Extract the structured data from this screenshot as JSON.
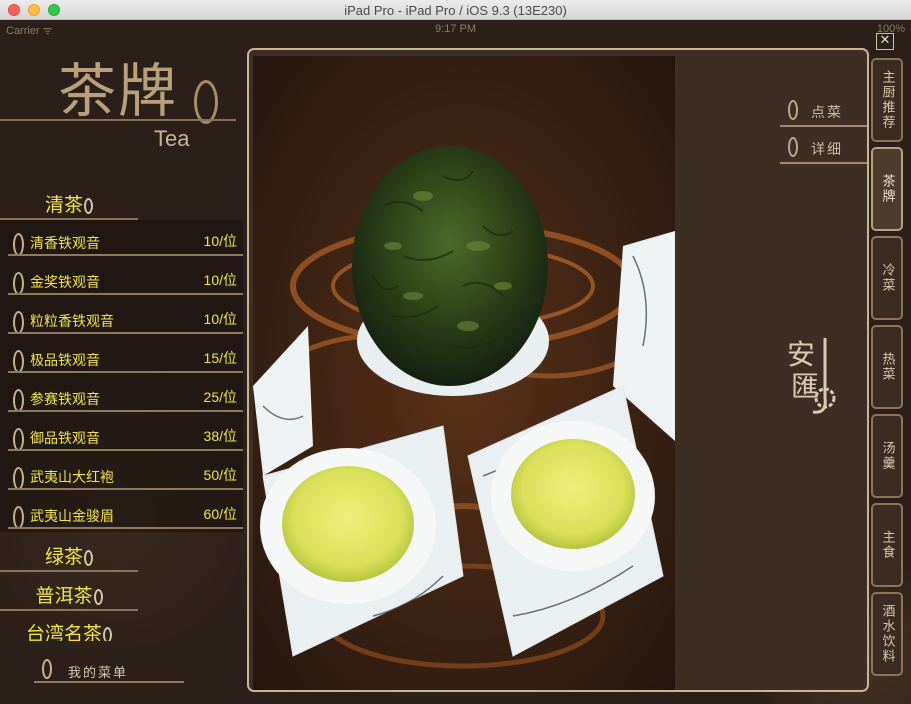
{
  "window": {
    "title": "iPad Pro - iPad Pro / iOS 9.3 (13E230)"
  },
  "statusbar": {
    "carrier": "Carrier ᯤ",
    "time": "9:17 PM",
    "battery": "100%"
  },
  "sidebar": {
    "logo_cn": "茶牌",
    "logo_en": "Tea",
    "categories": [
      {
        "label": "清茶"
      },
      {
        "label": "绿茶"
      },
      {
        "label": "普洱茶"
      },
      {
        "label": "台湾名茶"
      }
    ],
    "items": [
      {
        "name": "清香铁观音",
        "price": "10/位"
      },
      {
        "name": "金奖铁观音",
        "price": "10/位"
      },
      {
        "name": "粒粒香铁观音",
        "price": "10/位"
      },
      {
        "name": "极品铁观音",
        "price": "15/位"
      },
      {
        "name": "参赛铁观音",
        "price": "25/位"
      },
      {
        "name": "御品铁观音",
        "price": "38/位"
      },
      {
        "name": "武夷山大红袍",
        "price": "50/位"
      },
      {
        "name": "武夷山金骏眉",
        "price": "60/位"
      }
    ],
    "my_menu": "我的菜单"
  },
  "panel": {
    "order_label": "点菜",
    "detail_label": "详细",
    "seal_text": "安匯",
    "close_label": "✕"
  },
  "tabs": [
    {
      "label": "主厨推荐",
      "active": false
    },
    {
      "label": "茶牌",
      "active": true
    },
    {
      "label": "冷菜",
      "active": false
    },
    {
      "label": "热菜",
      "active": false
    },
    {
      "label": "汤羹",
      "active": false
    },
    {
      "label": "主食",
      "active": false
    },
    {
      "label": "酒水饮料",
      "active": false
    }
  ],
  "colors": {
    "accent_yellow": "#f3e44a",
    "gold_line": "#c9b58f",
    "background": "#2b2019"
  }
}
